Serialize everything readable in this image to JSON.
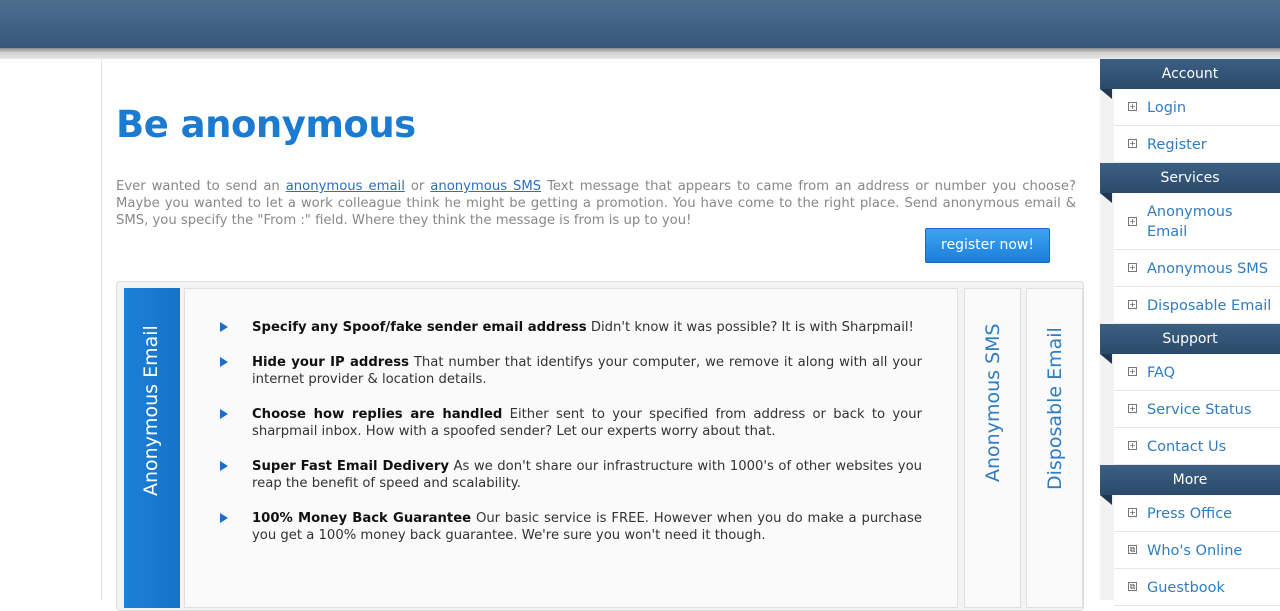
{
  "main": {
    "title": "Be anonymous",
    "intro": {
      "t1": "Ever wanted to send an ",
      "link1": "anonymous email",
      "t2": " or ",
      "link2": "anonymous SMS",
      "t3": " Text message that appears to came from an address or number you choose? Maybe you wanted to let a work colleague think he might be getting a promotion. You have come to the right place. Send anonymous email & SMS, you specify the \"From :\" field. Where they think the message is from is up to you!"
    },
    "register_button": "register now!",
    "tabs": {
      "active": "Anonymous Email",
      "sms": "Anonymous SMS",
      "disposable": "Disposable Email"
    },
    "features": [
      {
        "heading": "Specify any Spoof/fake sender email address",
        "text": " Didn't know it was possible? It is with Sharpmail!"
      },
      {
        "heading": "Hide your IP address",
        "text": " That number that identifys your computer, we remove it along with all your internet provider & location details."
      },
      {
        "heading": "Choose how replies are handled",
        "text": " Either sent to your specified from address or back to your sharpmail inbox. How with a spoofed sender? Let our experts worry about that."
      },
      {
        "heading": "Super Fast Email Dedivery",
        "text": " As we don't share our infrastructure with 1000's of other websites you reap the benefit of speed and scalability."
      },
      {
        "heading": "100% Money Back Guarantee",
        "text": " Our basic service is FREE. However when you do make a purchase you get a 100% money back guarantee. We're sure you won't need it though."
      }
    ]
  },
  "sidebar": {
    "account": {
      "title": "Account",
      "items": [
        "Login",
        "Register"
      ]
    },
    "services": {
      "title": "Services",
      "items": [
        "Anonymous Email",
        "Anonymous SMS",
        "Disposable Email"
      ]
    },
    "support": {
      "title": "Support",
      "items": [
        "FAQ",
        "Service Status",
        "Contact Us"
      ]
    },
    "more": {
      "title": "More",
      "items": [
        "Press Office",
        "Who's Online",
        "Guestbook"
      ]
    }
  }
}
